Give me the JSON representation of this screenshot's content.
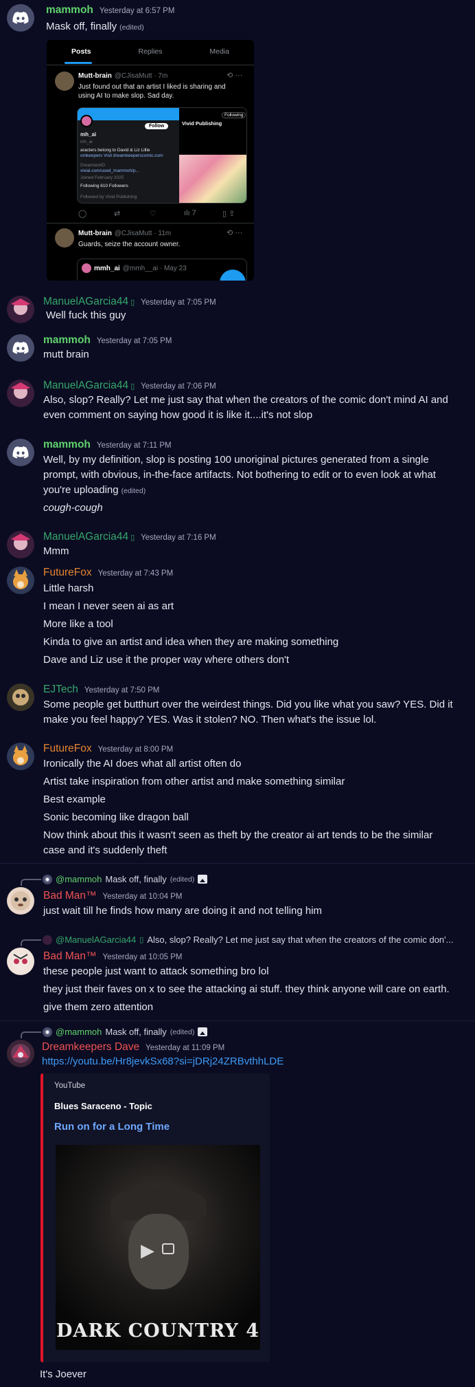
{
  "messages": {
    "m1": {
      "author": "mammoh",
      "time": "Yesterday at 6:57 PM",
      "text": "Mask off, finally",
      "edited": "(edited)"
    },
    "tweet": {
      "tabs": [
        "Posts",
        "Replies",
        "Media"
      ],
      "post1": {
        "name": "Mutt-brain",
        "handle": "@CJisaMutt · 7m",
        "text1": "Just found out that an artist I liked is sharing and",
        "text2": "using AI to make slop. Sad day."
      },
      "embed": {
        "name": "mh_ai",
        "handle": "mh_ai",
        "bio1": "aracters belong to David & Liz Lillie",
        "bio2": "omkeepers Visit dreamkeeperscomic.com",
        "loc": "DreamworlD",
        "link": "vivial.com/used_mammoh/p...",
        "joined": "Joined February 2025",
        "following": "Following  610 Followers",
        "followed": "Followed by Vivid Publishing",
        "follow_btn": "Follow",
        "right_name": "Vivid Publishing",
        "right_following": "Following"
      },
      "actions": {
        "views": "7"
      },
      "post2": {
        "name": "Mutt-brain",
        "handle": "@CJisaMutt · 11m",
        "text": "Guards, seize the account owner."
      },
      "quote": {
        "name": "mmh_ai",
        "handle": "@mmh__ai · May 23"
      }
    },
    "m2": {
      "author": "ManuelAGarcia44",
      "time": "Yesterday at 7:05 PM",
      "text": "Well fuck this guy"
    },
    "m3": {
      "author": "mammoh",
      "time": "Yesterday at 7:05 PM",
      "text": "mutt brain"
    },
    "m4": {
      "author": "ManuelAGarcia44",
      "time": "Yesterday at 7:06 PM",
      "line1": "Also, slop? Really? Let me just say that when the creators of the comic don't mind AI and",
      "line2": "even comment on saying how good it is like it....it's not slop"
    },
    "m5": {
      "author": "mammoh",
      "time": "Yesterday at 7:11 PM",
      "line1": "Well, by my definition, slop is posting 100 unoriginal pictures generated from a single",
      "line2": "prompt, with obvious, in-the-face artifacts. Not bothering to edit or to even look at what",
      "line3": "you're uploading",
      "edited": "(edited)",
      "line4": "cough-cough"
    },
    "m6": {
      "author": "ManuelAGarcia44",
      "time": "Yesterday at 7:16 PM",
      "text": "Mmm"
    },
    "m7": {
      "author": "FutureFox",
      "time": "Yesterday at 7:43 PM",
      "lines": [
        "Little harsh",
        "I mean I never seen ai as art",
        "More like a tool",
        "Kinda to give an artist and idea when they are making something",
        "Dave and Liz use it the proper way where others don't"
      ]
    },
    "m8": {
      "author": "EJTech",
      "time": "Yesterday at 7:50 PM",
      "line1": "Some people get butthurt over the weirdest things. Did you like what you saw? YES. Did it",
      "line2": "make you feel happy? YES. Was it stolen? NO. Then what's the issue lol."
    },
    "m9": {
      "author": "FutureFox",
      "time": "Yesterday at 8:00 PM",
      "lines": [
        "Ironically the AI does what all artist often do",
        "Artist take inspiration from other artist and make something similar",
        "Best example",
        "Sonic becoming like dragon ball",
        "Now think about this it wasn't seen as theft by the creator ai art tends to be the similar",
        "case and it's suddenly theft"
      ]
    },
    "m10": {
      "reply_user": "@mammoh",
      "reply_text": "Mask off, finally",
      "reply_edited": "(edited)",
      "author": "Bad Man™",
      "time": "Yesterday at 10:04 PM",
      "text": "just wait till he finds how many are doing it and not telling him"
    },
    "m11": {
      "reply_user": "@ManuelAGarcia44",
      "reply_text": "Also, slop? Really? Let me just say that when the creators of the comic don'...",
      "author": "Bad Man™",
      "time": "Yesterday at 10:05 PM",
      "lines": [
        "these people just want to attack something bro lol",
        "they just their faves on x to see the attacking ai stuff. they think anyone will care on earth.",
        "give them zero attention"
      ]
    },
    "m12": {
      "reply_user": "@mammoh",
      "reply_text": "Mask off, finally",
      "reply_edited": "(edited)",
      "author": "Dreamkeepers Dave",
      "time": "Yesterday at 11:09 PM",
      "link": "https://youtu.be/Hr8jevkSx68?si=jDRj24ZRBvthhLDE",
      "embed": {
        "provider": "YouTube",
        "channel": "Blues Saraceno - Topic",
        "title": "Run on for a Long Time",
        "thumb_text": "DARK COUNTRY 4"
      },
      "after": "It's Joever"
    }
  },
  "colors": {
    "background": "#0b0c22",
    "mammoh": "#5fd36b",
    "manuel": "#35a76a",
    "futurefox": "#e7852e",
    "badman": "#f05252",
    "link": "#3e9bf5",
    "embed_bar": "#e0142b"
  },
  "icons": [
    "discord-icon",
    "image-icon",
    "play-icon",
    "open-external-icon",
    "verified-badge-icon"
  ]
}
